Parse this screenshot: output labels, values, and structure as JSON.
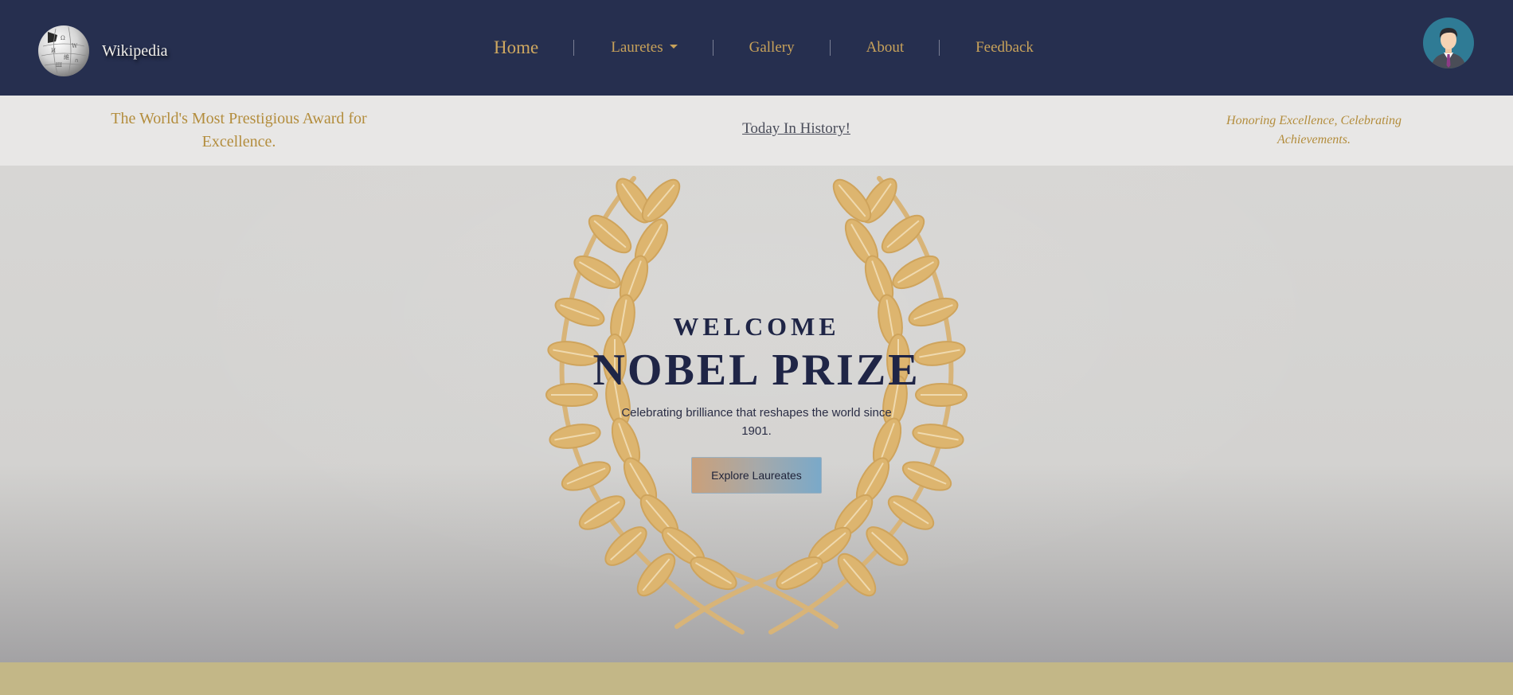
{
  "navbar": {
    "brand_name": "Wikipedia",
    "links": {
      "home": "Home",
      "laureates": "Lauretes",
      "gallery": "Gallery",
      "about": "About",
      "feedback": "Feedback"
    },
    "globe_icon": "wikipedia-globe-icon",
    "avatar_icon": "user-avatar-icon"
  },
  "subbar": {
    "tagline_left": "The World's Most Prestigious Award for Excellence.",
    "today_link": "Today In History!",
    "tagline_right": "Honoring Excellence, Celebrating Achievements."
  },
  "hero": {
    "welcome": "WELCOME",
    "title": "NOBEL PRIZE",
    "subtitle": "Celebrating brilliance that reshapes the world since 1901.",
    "cta": "Explore Laureates",
    "wreath_icon": "laurel-wreath-icon"
  },
  "colors": {
    "navbar_bg": "#262f4f",
    "gold": "#c8a25a",
    "subbar_bg": "#e8e7e6",
    "hero_text": "#1f2546",
    "bottom_strip": "#c3b787"
  }
}
